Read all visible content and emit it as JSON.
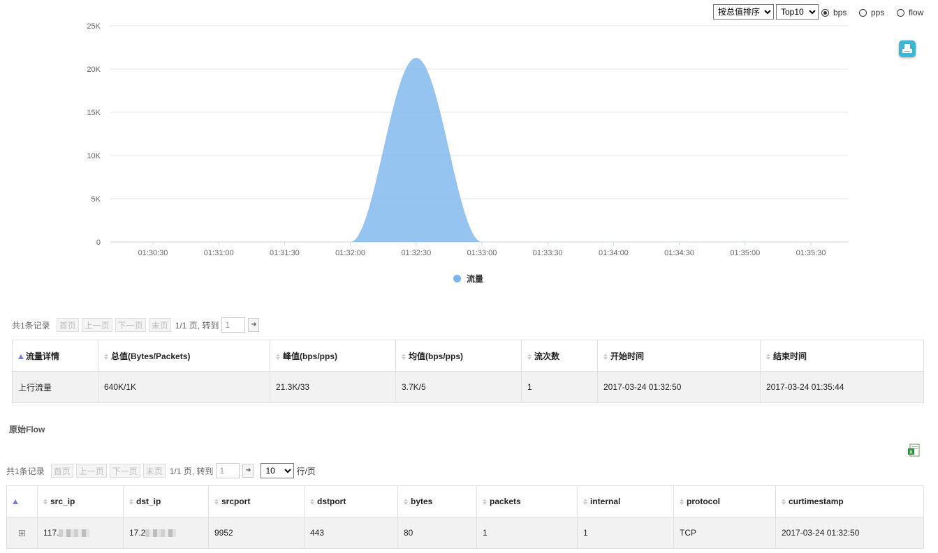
{
  "controls": {
    "sort_select": "按总值排序",
    "top_select": "Top10",
    "radios": [
      {
        "label": "bps",
        "checked": true
      },
      {
        "label": "pps",
        "checked": false
      },
      {
        "label": "flow",
        "checked": false
      }
    ]
  },
  "chart_data": {
    "type": "area",
    "x": [
      "01:30:30",
      "01:31:00",
      "01:31:30",
      "01:32:00",
      "01:32:30",
      "01:33:00",
      "01:33:30",
      "01:34:00",
      "01:34:30",
      "01:35:00",
      "01:35:30"
    ],
    "y_ticks": [
      "0",
      "5K",
      "10K",
      "15K",
      "20K",
      "25K"
    ],
    "ylim": [
      0,
      25000
    ],
    "series": [
      {
        "name": "流量",
        "peak_time": "01:32:30",
        "peak_value": 21300,
        "start_time": "01:32:00",
        "end_time": "01:33:00",
        "color": "#7cb5ec"
      }
    ],
    "legend": "bottom-center",
    "grid": true
  },
  "summary": {
    "pager": {
      "count": "共1条记录",
      "first": "首页",
      "prev": "上一页",
      "next": "下一页",
      "last": "末页",
      "pages": "1/1 页, 转到",
      "jump_value": "1"
    },
    "headers": [
      "流量详情",
      "总值(Bytes/Packets)",
      "峰值(bps/pps)",
      "均值(bps/pps)",
      "流次数",
      "开始时间",
      "结束时间"
    ],
    "rows": [
      [
        "上行流量",
        "640K/1K",
        "21.3K/33",
        "3.7K/5",
        "1",
        "2017-03-24 01:32:50",
        "2017-03-24 01:35:44"
      ]
    ]
  },
  "raw_flow": {
    "title": "原始Flow",
    "pager": {
      "count": "共1条记录",
      "first": "首页",
      "prev": "上一页",
      "next": "下一页",
      "last": "末页",
      "pages": "1/1 页, 转到",
      "jump_value": "1",
      "page_size": "10",
      "per_page": "行/页"
    },
    "headers": [
      "src_ip",
      "dst_ip",
      "srcport",
      "dstport",
      "bytes",
      "packets",
      "internal",
      "protocol",
      "curtimestamp"
    ],
    "rows": [
      {
        "src_ip": "117.",
        "dst_ip": "17.2",
        "srcport": "9952",
        "dstport": "443",
        "bytes": "80",
        "packets": "1",
        "internal": "1",
        "protocol": "TCP",
        "curtimestamp": "2017-03-24 01:32:50"
      }
    ]
  },
  "colors": {
    "accent": "#7cb5ec",
    "print_button": "#3db6d6"
  }
}
